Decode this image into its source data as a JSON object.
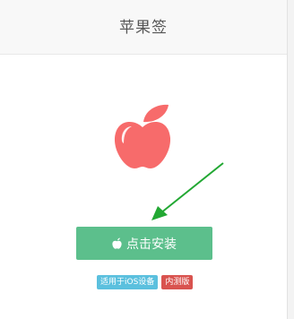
{
  "header": {
    "title": "苹果签"
  },
  "main": {
    "logo_icon": "apple-icon",
    "install_button": {
      "label": "点击安装",
      "icon": "apple-icon"
    },
    "badges": [
      {
        "label": "适用于iOS设备",
        "color": "#5bc0de"
      },
      {
        "label": "内测版",
        "color": "#d9534f"
      }
    ]
  },
  "colors": {
    "accent_green": "#5cbf8c",
    "logo_red": "#f76b6b",
    "arrow_green": "#22a833"
  }
}
